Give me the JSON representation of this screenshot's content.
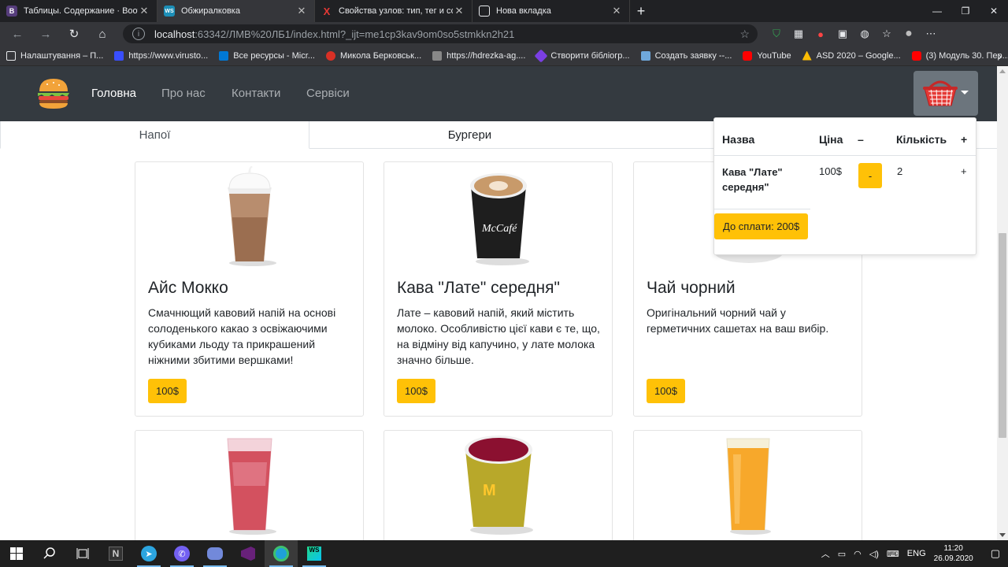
{
  "browser": {
    "tabs": [
      {
        "title": "Таблицы. Содержание · Bootstr",
        "favicon": "B",
        "favicon_color": "#563d7c",
        "active": false
      },
      {
        "title": "Обжиралковка",
        "favicon": "WS",
        "favicon_color": "#1c8fb8",
        "active": true
      },
      {
        "title": "Свойства узлов: тип, тег и соде",
        "favicon": "X",
        "favicon_color": "#202124",
        "active": false
      },
      {
        "title": "Нова вкладка",
        "favicon": "▣",
        "favicon_color": "#202124",
        "active": false
      }
    ],
    "url_host": "localhost",
    "url_rest": ":63342/ЛМВ%20ЛБ1/index.html?_ijt=me1cp3kav9om0so5stmkkn2h21",
    "bookmarks": [
      {
        "label": "Налаштування – П...",
        "color": "#e8eaed"
      },
      {
        "label": "https://www.virusto...",
        "color": "#394eff"
      },
      {
        "label": "Все ресурсы - Micr...",
        "color": "#0078d4"
      },
      {
        "label": "Микола Берковськ...",
        "color": "#d93025"
      },
      {
        "label": "https://hdrezka-ag....",
        "color": "#888888"
      },
      {
        "label": "Створити бібліогр...",
        "color": "#7b3fe4"
      },
      {
        "label": "Создать заявку --...",
        "color": "#6fa8dc"
      },
      {
        "label": "YouTube",
        "color": "#ff0000"
      },
      {
        "label": "ASD 2020 – Google...",
        "color": "#fbbc04"
      },
      {
        "label": "(3) Модуль 30. Пер...",
        "color": "#ff0000"
      }
    ]
  },
  "nav": {
    "links": [
      "Головна",
      "Про нас",
      "Контакти",
      "Сервіси"
    ]
  },
  "tabs": {
    "drinks": "Напої",
    "burgers": "Бургери"
  },
  "products": [
    {
      "name": "Айс Мокко",
      "desc": "Смачнющий кавовий напій на основі солоденького какао з освіжаючими кубиками льоду та прикрашений ніжними збитими вершками!",
      "price": "100$"
    },
    {
      "name": "Кава \"Лате\" середня\"",
      "desc": "Лате – кавовий напій, який містить молоко. Особливістю цієї кави є те, що, на відміну від капучино, у лате молока значно більше.",
      "price": "100$"
    },
    {
      "name": "Чай чорний",
      "desc": "Оригінальний чорний чай у герметичних сашетах на ваш вибір.",
      "price": "100$"
    }
  ],
  "cart": {
    "headers": {
      "name": "Назва",
      "price": "Ціна",
      "minus": "–",
      "qty": "Кількість",
      "plus": "+"
    },
    "item": {
      "name": "Кава \"Лате\" середня\"",
      "price": "100$",
      "minus": "-",
      "qty": "2",
      "plus": "+"
    },
    "total": "До сплати: 200$"
  },
  "taskbar": {
    "lang": "ENG",
    "time": "11:20",
    "date": "26.09.2020"
  }
}
